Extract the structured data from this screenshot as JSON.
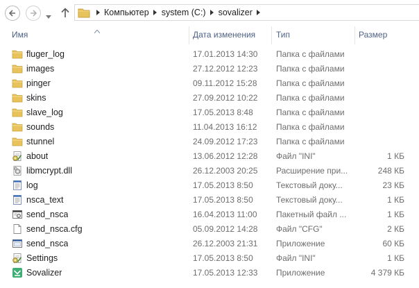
{
  "window": {
    "title": "sovalizer"
  },
  "address": {
    "crumbs": [
      "Компьютер",
      "system (C:)",
      "sovalizer"
    ]
  },
  "columns": {
    "name": "Имя",
    "date": "Дата изменения",
    "type": "Тип",
    "size": "Размер"
  },
  "files": [
    {
      "name": "fluger_log",
      "date": "17.01.2013 14:30",
      "type": "Папка с файлами",
      "size": "",
      "icon": "folder-icon"
    },
    {
      "name": "images",
      "date": "27.12.2012 12:23",
      "type": "Папка с файлами",
      "size": "",
      "icon": "folder-icon"
    },
    {
      "name": "pinger",
      "date": "09.11.2012 15:28",
      "type": "Папка с файлами",
      "size": "",
      "icon": "folder-icon"
    },
    {
      "name": "skins",
      "date": "27.09.2012 10:22",
      "type": "Папка с файлами",
      "size": "",
      "icon": "folder-icon"
    },
    {
      "name": "slave_log",
      "date": "17.05.2013 8:48",
      "type": "Папка с файлами",
      "size": "",
      "icon": "folder-icon"
    },
    {
      "name": "sounds",
      "date": "11.04.2013 16:12",
      "type": "Папка с файлами",
      "size": "",
      "icon": "folder-icon"
    },
    {
      "name": "stunnel",
      "date": "24.09.2012 17:23",
      "type": "Папка с файлами",
      "size": "",
      "icon": "folder-icon"
    },
    {
      "name": "about",
      "date": "13.06.2012 12:28",
      "type": "Файл \"INI\"",
      "size": "1 КБ",
      "icon": "ini-settings-icon"
    },
    {
      "name": "libmcrypt.dll",
      "date": "26.12.2003 20:25",
      "type": "Расширение при...",
      "size": "248 КБ",
      "icon": "dll-icon"
    },
    {
      "name": "log",
      "date": "17.05.2013 8:50",
      "type": "Текстовый доку...",
      "size": "23 КБ",
      "icon": "text-document-icon"
    },
    {
      "name": "nsca_text",
      "date": "17.05.2013 8:50",
      "type": "Текстовый доку...",
      "size": "1 КБ",
      "icon": "text-document-icon"
    },
    {
      "name": "send_nsca",
      "date": "16.04.2013 11:00",
      "type": "Пакетный файл ...",
      "size": "1 КБ",
      "icon": "batch-file-icon"
    },
    {
      "name": "send_nsca.cfg",
      "date": "05.09.2012 14:28",
      "type": "Файл \"CFG\"",
      "size": "2 КБ",
      "icon": "blank-file-icon"
    },
    {
      "name": "send_nsca",
      "date": "26.12.2003 21:31",
      "type": "Приложение",
      "size": "60 КБ",
      "icon": "exe-icon"
    },
    {
      "name": "Settings",
      "date": "17.05.2013 8:50",
      "type": "Файл \"INI\"",
      "size": "1 КБ",
      "icon": "ini-settings-icon"
    },
    {
      "name": "Sovalizer",
      "date": "17.05.2013 12:33",
      "type": "Приложение",
      "size": "4 379 КБ",
      "icon": "sovalizer-app-icon"
    }
  ],
  "colors": {
    "header_text": "#4d6185",
    "folder": "#e8c25a",
    "secondary_text": "#6d6d6d"
  }
}
